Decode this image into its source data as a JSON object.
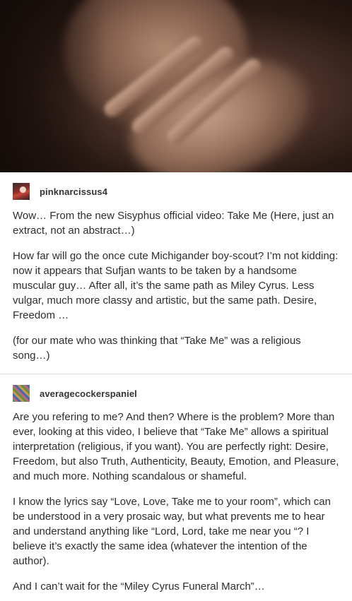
{
  "photo": {
    "alt_icon": "photo-image"
  },
  "posts": [
    {
      "username": "pinknarcissus4",
      "paragraphs": [
        "Wow… From the new Sisyphus official video: Take Me (Here, just an extract, not an abstract…)",
        "How far will go the once cute Michigander boy-scout? I’m not kidding: now it appears that Sufjan wants to be taken by a handsome muscular guy… After all, it’s the same path as Miley Cyrus. Less vulgar, much more classy and artistic, but the same path. Desire, Freedom …",
        "(for our mate who was thinking that “Take Me” was a religious song…)"
      ]
    },
    {
      "username": "averagecockerspaniel",
      "paragraphs": [
        "Are you refering to me? And then? Where is the problem? More than ever, looking at this video, I believe that “Take Me” allows a spiritual interpretation (religious, if you want). You are perfectly right: Desire, Freedom, but also Truth, Authenticity, Beauty, Emotion, and Pleasure, and much more. Nothing scandalous or shameful.",
        "I know the lyrics say “Love, Love, Take me to your room”, which can be understood in a very prosaic way, but what prevents me to hear and understand anything like “Lord, Lord, take me near you “? I believe it’s exactly the same idea (whatever the intention of the author).",
        "And I can’t wait for the “Miley Cyrus Funeral March”…"
      ]
    }
  ]
}
